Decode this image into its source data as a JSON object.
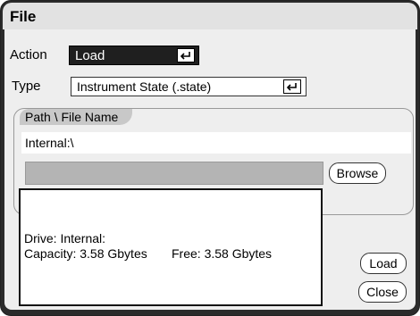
{
  "dialog": {
    "title": "File"
  },
  "action": {
    "label": "Action",
    "value": "Load"
  },
  "type": {
    "label": "Type",
    "value": "Instrument State (.state)"
  },
  "path": {
    "group_label": "Path \\ File Name",
    "value": "Internal:\\",
    "browse_label": "Browse"
  },
  "info": {
    "drive": "Drive: Internal:",
    "capacity": "Capacity: 3.58 Gbytes",
    "free": "Free: 3.58 Gbytes"
  },
  "buttons": {
    "load_label": "Load",
    "close_label": "Close"
  },
  "icons": {
    "enter": "enter-key-icon"
  }
}
